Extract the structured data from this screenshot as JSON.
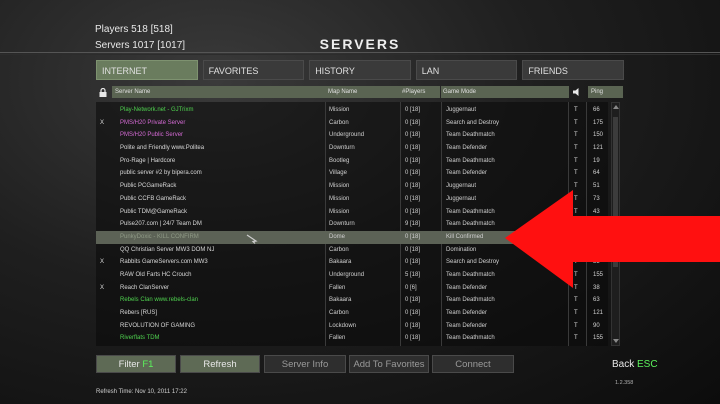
{
  "header": {
    "players": "Players 518 [518]",
    "servers": "Servers 1017 [1017]",
    "title": "SERVERS"
  },
  "tabs": [
    {
      "label": "INTERNET",
      "active": true
    },
    {
      "label": "FAVORITES",
      "active": false
    },
    {
      "label": "HISTORY",
      "active": false
    },
    {
      "label": "LAN",
      "active": false
    },
    {
      "label": "FRIENDS",
      "active": false
    }
  ],
  "columns": {
    "server_name": "Server Name",
    "map_name": "Map Name",
    "players": "#Players",
    "game_mode": "Game Mode",
    "ping": "Ping"
  },
  "rows": [
    {
      "pw": "",
      "name": "Play-Network.net - GJTrixm",
      "name_color": "#4fd24f",
      "map": "Mission",
      "players": "0 [18]",
      "mode": "Juggernaut",
      "t": "T",
      "ping": "66"
    },
    {
      "pw": "X",
      "name": "PMS/H20 Private Server",
      "name_color": "#d46ad4",
      "map": "Carbon",
      "players": "0 [18]",
      "mode": "Search and Destroy",
      "t": "T",
      "ping": "175"
    },
    {
      "pw": "",
      "name": "PMS/H20 Public Server",
      "name_color": "#d46ad4",
      "map": "Underground",
      "players": "0 [18]",
      "mode": "Team Deathmatch",
      "t": "T",
      "ping": "150"
    },
    {
      "pw": "",
      "name": "Polite and Friendly www.Politea",
      "name_color": "#d8d8d8",
      "map": "Downturn",
      "players": "0 [18]",
      "mode": "Team Defender",
      "t": "T",
      "ping": "121"
    },
    {
      "pw": "",
      "name": "Pro-Rage | Hardcore",
      "name_color": "#d8d8d8",
      "map": "Bootleg",
      "players": "0 [18]",
      "mode": "Team Deathmatch",
      "t": "T",
      "ping": "19"
    },
    {
      "pw": "",
      "name": "public server #2 by bipera.com",
      "name_color": "#d8d8d8",
      "map": "Village",
      "players": "0 [18]",
      "mode": "Team Defender",
      "t": "T",
      "ping": "64"
    },
    {
      "pw": "",
      "name": "Public PCGameRack",
      "name_color": "#d8d8d8",
      "map": "Mission",
      "players": "0 [18]",
      "mode": "Juggernaut",
      "t": "T",
      "ping": "51"
    },
    {
      "pw": "",
      "name": "Public CCFB GameRack",
      "name_color": "#d8d8d8",
      "map": "Mission",
      "players": "0 [18]",
      "mode": "Juggernaut",
      "t": "T",
      "ping": "73"
    },
    {
      "pw": "",
      "name": "Public TDM@GameRack",
      "name_color": "#d8d8d8",
      "map": "Mission",
      "players": "0 [18]",
      "mode": "Team Deathmatch",
      "t": "T",
      "ping": "43"
    },
    {
      "pw": "",
      "name": "Pulse207.com | 24/7 Team DM",
      "name_color": "#d8d8d8",
      "map": "Downturn",
      "players": "9 [18]",
      "mode": "Team Deathmatch",
      "t": "",
      "ping": ""
    },
    {
      "pw": "",
      "name": "PunkyDoxic - KILL CONFIRM",
      "name_color": "#8f9a86",
      "map": "Dome",
      "players": "0 [18]",
      "mode": "Kill Confirmed",
      "t": "",
      "ping": "",
      "selected": true
    },
    {
      "pw": "",
      "name": "QQ Christian Server MW3 DOM NJ",
      "name_color": "#d8d8d8",
      "map": "Carbon",
      "players": "0 [18]",
      "mode": "Domination",
      "t": "",
      "ping": ""
    },
    {
      "pw": "X",
      "name": "Rabbits GameServers.com MW3",
      "name_color": "#d8d8d8",
      "map": "Bakaara",
      "players": "0 [18]",
      "mode": "Search and Destroy",
      "t": "T",
      "ping": "55"
    },
    {
      "pw": "",
      "name": "RAW Old Farts HC Crouch",
      "name_color": "#d8d8d8",
      "map": "Underground",
      "players": "5 [18]",
      "mode": "Team Deathmatch",
      "t": "T",
      "ping": "155"
    },
    {
      "pw": "X",
      "name": "Reach ClanServer",
      "name_color": "#d8d8d8",
      "map": "Fallen",
      "players": "0 [6]",
      "mode": "Team Defender",
      "t": "T",
      "ping": "38"
    },
    {
      "pw": "",
      "name": "Rebels Clan www.rebels-clan",
      "name_color": "#4fd24f",
      "map": "Bakaara",
      "players": "0 [18]",
      "mode": "Team Deathmatch",
      "t": "T",
      "ping": "63"
    },
    {
      "pw": "",
      "name": "Rebers [RUS]",
      "name_color": "#d8d8d8",
      "map": "Carbon",
      "players": "0 [18]",
      "mode": "Team Defender",
      "t": "T",
      "ping": "121"
    },
    {
      "pw": "",
      "name": "REVOLUTION OF GAMING",
      "name_color": "#d8d8d8",
      "map": "Lockdown",
      "players": "0 [18]",
      "mode": "Team Defender",
      "t": "T",
      "ping": "90"
    },
    {
      "pw": "",
      "name": "Riverflats TDM",
      "name_color": "#4fd24f",
      "map": "Fallen",
      "players": "0 [18]",
      "mode": "Team Deathmatch",
      "t": "T",
      "ping": "155"
    }
  ],
  "buttons": {
    "filter": "Filter",
    "filter_key": "F1",
    "refresh": "Refresh",
    "server_info": "Server Info",
    "add_favorites": "Add To Favorites",
    "connect": "Connect"
  },
  "footer": {
    "back": "Back",
    "back_key": "ESC",
    "version": "1.2.358",
    "refresh_time": "Refresh Time: Nov 10, 2011 17:22"
  },
  "colors": {
    "accent_green": "#5cf25c",
    "active_tab": "#6a7c5e",
    "annotation_arrow": "#ff1010"
  }
}
